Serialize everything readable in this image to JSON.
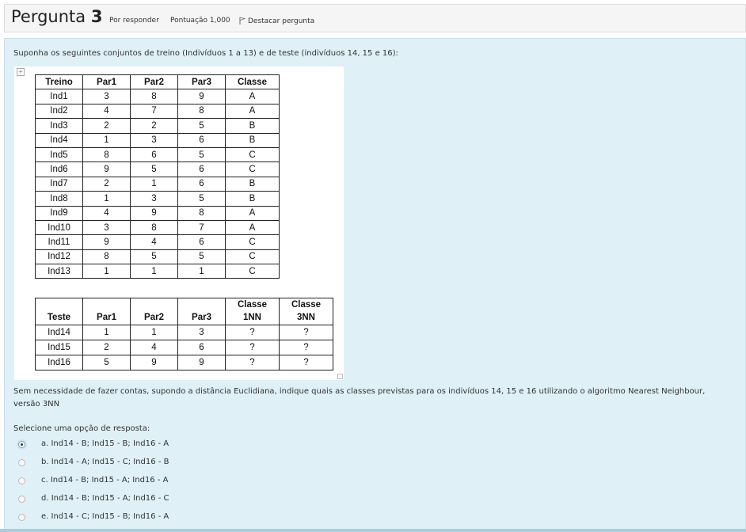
{
  "header": {
    "title_word": "Pergunta",
    "title_number": "3",
    "status": "Por responder",
    "score": "Pontuação 1,000",
    "flag_label": "Destacar pergunta"
  },
  "intro": "Suponha os seguintes conjuntos de treino (Indivíduos 1 a 13) e de teste (indivíduos 14, 15 e 16):",
  "train_table": {
    "headers": [
      "Treino",
      "Par1",
      "Par2",
      "Par3",
      "Classe"
    ],
    "rows": [
      [
        "Ind1",
        "3",
        "8",
        "9",
        "A"
      ],
      [
        "Ind2",
        "4",
        "7",
        "8",
        "A"
      ],
      [
        "Ind3",
        "2",
        "2",
        "5",
        "B"
      ],
      [
        "Ind4",
        "1",
        "3",
        "6",
        "B"
      ],
      [
        "Ind5",
        "8",
        "6",
        "5",
        "C"
      ],
      [
        "Ind6",
        "9",
        "5",
        "6",
        "C"
      ],
      [
        "Ind7",
        "2",
        "1",
        "6",
        "B"
      ],
      [
        "Ind8",
        "1",
        "3",
        "5",
        "B"
      ],
      [
        "Ind9",
        "4",
        "9",
        "8",
        "A"
      ],
      [
        "Ind10",
        "3",
        "8",
        "7",
        "A"
      ],
      [
        "Ind11",
        "9",
        "4",
        "6",
        "C"
      ],
      [
        "Ind12",
        "8",
        "5",
        "5",
        "C"
      ],
      [
        "Ind13",
        "1",
        "1",
        "1",
        "C"
      ]
    ]
  },
  "test_table": {
    "headers": [
      [
        "Teste"
      ],
      [
        "Par1"
      ],
      [
        "Par2"
      ],
      [
        "Par3"
      ],
      [
        "Classe",
        "1NN"
      ],
      [
        "Classe",
        "3NN"
      ]
    ],
    "rows": [
      [
        "Ind14",
        "1",
        "1",
        "3",
        "?",
        "?"
      ],
      [
        "Ind15",
        "2",
        "4",
        "6",
        "?",
        "?"
      ],
      [
        "Ind16",
        "5",
        "9",
        "9",
        "?",
        "?"
      ]
    ]
  },
  "question": "Sem necessidade de fazer contas, supondo a distância Euclidiana, indique quais as classes previstas para os indivíduos 14, 15 e 16 utilizando o algoritmo Nearest Neighbour, versão 3NN",
  "prompt": "Selecione uma opção de resposta:",
  "options": [
    {
      "label": "a. Ind14 - B; Ind15 - B; Ind16 - A",
      "selected": true
    },
    {
      "label": "b. Ind14 - A; Ind15 - C; Ind16 - B",
      "selected": false
    },
    {
      "label": "c. Ind14 - B; Ind15 - A; Ind16 - A",
      "selected": false
    },
    {
      "label": "d. Ind14 - B; Ind15 - A; Ind16 - C",
      "selected": false
    },
    {
      "label": "e. Ind14 - C; Ind15 - B; Ind16 - A",
      "selected": false
    }
  ]
}
